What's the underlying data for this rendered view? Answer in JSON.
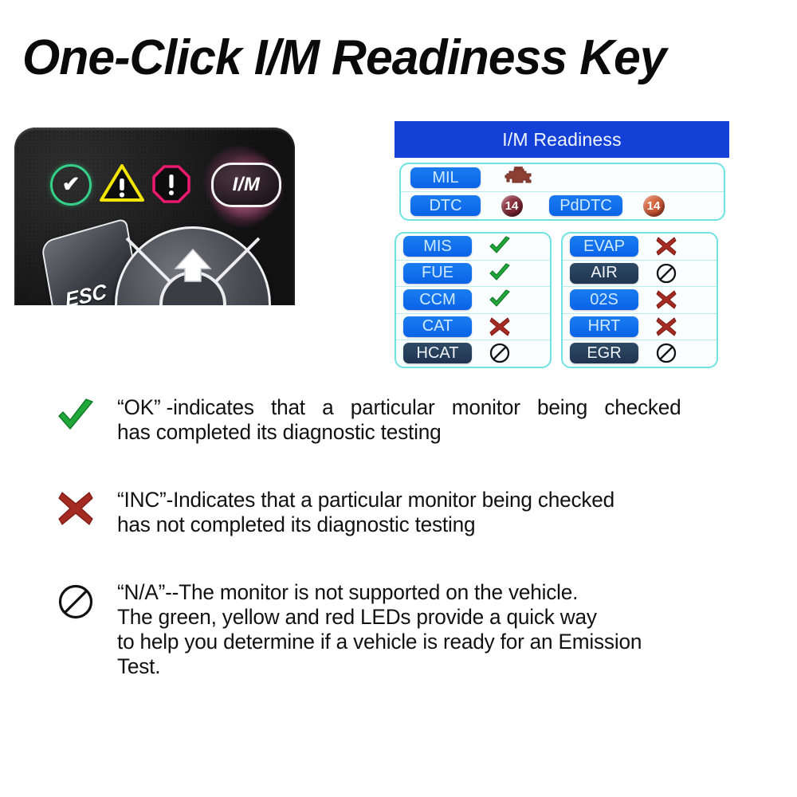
{
  "title": "One-Click I/M Readiness Key",
  "device": {
    "leds": [
      {
        "name": "green-ok-led",
        "shape": "circle",
        "glyph": "✔",
        "color": "#35d08a"
      },
      {
        "name": "yellow-warning-led",
        "shape": "triangle",
        "glyph": "!",
        "color": "#f2e500"
      },
      {
        "name": "red-alert-led",
        "shape": "octagon",
        "glyph": "!",
        "color": "#e8196e"
      }
    ],
    "im_button_label": "I/M",
    "esc_key_label": "ESC",
    "dpad_label": "up-arrow"
  },
  "table": {
    "header": "I/M Readiness",
    "top_rows": [
      {
        "label": "MIL",
        "label_style": "blue",
        "value_type": "engine-icon",
        "value": ""
      },
      {
        "label": "DTC",
        "label_style": "blue",
        "value_type": "badge-dark-red",
        "value": "14",
        "label2": "PdDTC",
        "label2_style": "blue",
        "value2_type": "badge-orange",
        "value2": "14"
      }
    ],
    "left_column": [
      {
        "label": "MIS",
        "label_style": "blue",
        "status": "ok"
      },
      {
        "label": "FUE",
        "label_style": "blue",
        "status": "ok"
      },
      {
        "label": "CCM",
        "label_style": "blue",
        "status": "ok"
      },
      {
        "label": "CAT",
        "label_style": "blue",
        "status": "inc"
      },
      {
        "label": "HCAT",
        "label_style": "dark",
        "status": "na"
      }
    ],
    "right_column": [
      {
        "label": "EVAP",
        "label_style": "blue",
        "status": "inc"
      },
      {
        "label": "AIR",
        "label_style": "dark",
        "status": "na"
      },
      {
        "label": "02S",
        "label_style": "blue",
        "status": "inc"
      },
      {
        "label": "HRT",
        "label_style": "blue",
        "status": "inc"
      },
      {
        "label": "EGR",
        "label_style": "dark",
        "status": "na"
      }
    ],
    "colors": {
      "header_blue": "#1340d6",
      "chip_blue": "#0a63e8",
      "chip_dark": "#2f4a66",
      "border_cyan": "#6fe3e3",
      "ok_green": "#1ea038",
      "inc_red": "#a32b22"
    }
  },
  "legend": [
    {
      "icon": "green-check-icon",
      "line1a": "“OK” -indicates   that   a   particular   monitor   being   checked",
      "line1": "“OK” -indicates that a particular monitor being checked",
      "line2": "has completed its diagnostic testing"
    },
    {
      "icon": "red-cross-icon",
      "line1": "“INC”-Indicates that a particular monitor being checked",
      "line2": "has not completed its diagnostic testing"
    },
    {
      "icon": "na-circle-slash-icon",
      "line1": "“N/A”--The monitor is not supported on the vehicle.",
      "line2": "The green, yellow and red LEDs provide a quick way",
      "line3": "to help you determine if a vehicle is ready for an Emission",
      "line4": "Test."
    }
  ]
}
